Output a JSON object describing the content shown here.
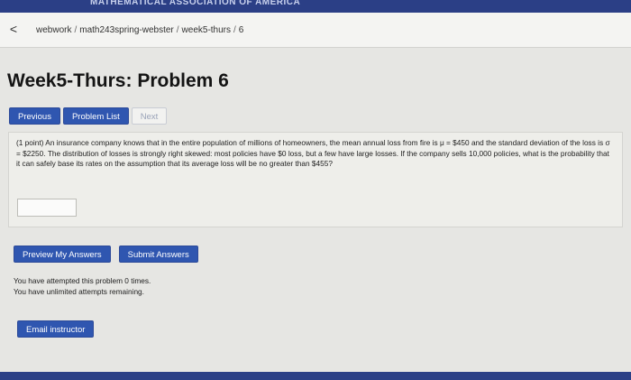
{
  "topbar": {
    "title": "MATHEMATICAL ASSOCIATION OF AMERICA"
  },
  "breadcrumb": {
    "back_label": "<",
    "items": [
      "webwork",
      "math243spring-webster",
      "week5-thurs",
      "6"
    ],
    "separator": "/"
  },
  "page": {
    "title": "Week5-Thurs: Problem 6"
  },
  "nav": {
    "previous_label": "Previous",
    "problem_list_label": "Problem List",
    "next_label": "Next"
  },
  "problem": {
    "text": "(1 point) An insurance company knows that in the entire population of millions of homeowners, the mean annual loss from fire is μ = $450 and the standard deviation of the loss is σ = $2250. The distribution of losses is strongly right skewed: most policies have $0 loss, but a few have large losses. If the company sells 10,000 policies, what is the probability that it can safely base its rates on the assumption that its average loss will be no greater than $455?",
    "answer_value": ""
  },
  "actions": {
    "preview_label": "Preview My Answers",
    "submit_label": "Submit Answers"
  },
  "attempts": {
    "line1": "You have attempted this problem 0 times.",
    "line2": "You have unlimited attempts remaining."
  },
  "email": {
    "label": "Email instructor"
  },
  "colors": {
    "primary_button": "#2f56b0",
    "header_bar": "#2b3f86",
    "page_background": "#e6e6e3"
  }
}
